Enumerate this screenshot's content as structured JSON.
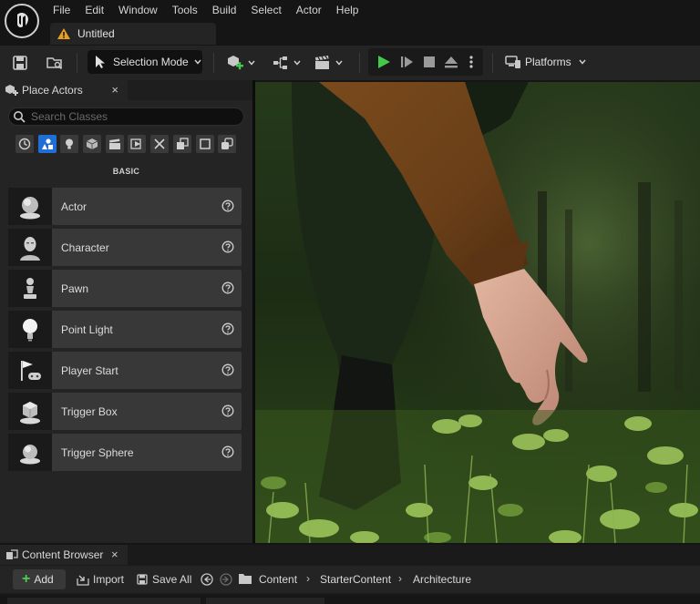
{
  "menu": {
    "items": [
      "File",
      "Edit",
      "Window",
      "Tools",
      "Build",
      "Select",
      "Actor",
      "Help"
    ]
  },
  "document_tab": {
    "label": "Untitled"
  },
  "toolbar": {
    "selection_mode_label": "Selection Mode",
    "platforms_label": "Platforms"
  },
  "place_actors": {
    "tab_label": "Place Actors",
    "close_glyph": "×",
    "search_placeholder": "Search Classes",
    "category_label": "BASIC",
    "actors": [
      {
        "name": "Actor"
      },
      {
        "name": "Character"
      },
      {
        "name": "Pawn"
      },
      {
        "name": "Point Light"
      },
      {
        "name": "Player Start"
      },
      {
        "name": "Trigger Box"
      },
      {
        "name": "Trigger Sphere"
      }
    ]
  },
  "content_browser": {
    "tab_label": "Content Browser",
    "close_glyph": "×",
    "add_label": "Add",
    "import_label": "Import",
    "save_all_label": "Save All",
    "breadcrumbs": [
      "Content",
      "StarterContent",
      "Architecture"
    ]
  },
  "colors": {
    "accent_blue": "#1f6fd6",
    "play_green": "#43c84a",
    "warning_orange": "#e8a020"
  }
}
